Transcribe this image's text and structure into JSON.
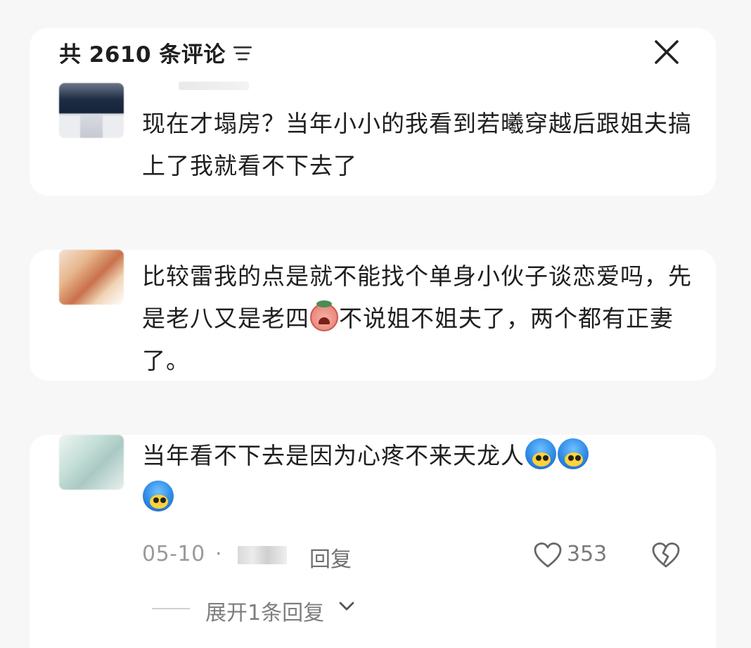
{
  "header": {
    "title": "共 2610 条评论"
  },
  "comments": [
    {
      "text": "现在才塌房？当年小小的我看到若曦穿越后跟姐夫搞上了我就看不下去了"
    },
    {
      "text_parts": [
        "比较雷我的点是就不能找个单身小伙子谈恋爱吗，先是老八又是老四",
        "不说姐不姐夫了，两个都有正妻了。"
      ]
    },
    {
      "text": "当年看不下去是因为心疼不来天龙人",
      "date": "05-10",
      "separator": "·",
      "reply_label": "回复",
      "like_count": "353",
      "expand_label": "展开1条回复"
    }
  ],
  "icons": {
    "sort": "sort-icon",
    "close": "close-icon",
    "like": "heart-outline-icon",
    "dislike": "broken-heart-icon",
    "expand": "chevron-down-icon"
  },
  "colors": {
    "text": "#1f1f1f",
    "meta": "#9a9a9a",
    "background": "#f7f7f7"
  }
}
